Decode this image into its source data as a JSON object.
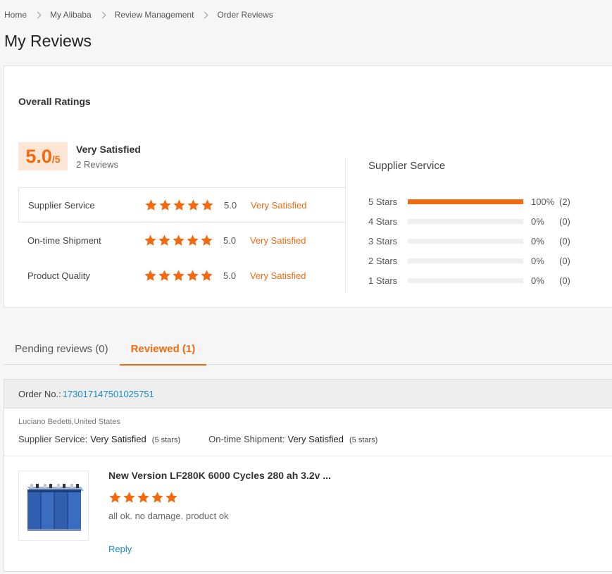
{
  "breadcrumb": [
    "Home",
    "My Alibaba",
    "Review Management",
    "Order Reviews"
  ],
  "page_title": "My Reviews",
  "overall": {
    "title": "Overall Ratings",
    "score": "5.0",
    "score_max": "/5",
    "label": "Very Satisfied",
    "review_count": "2 Reviews",
    "rows": [
      {
        "name": "Supplier Service",
        "stars": 5,
        "value": "5.0",
        "label": "Very Satisfied"
      },
      {
        "name": "On-time Shipment",
        "stars": 5,
        "value": "5.0",
        "label": "Very Satisfied"
      },
      {
        "name": "Product Quality",
        "stars": 5,
        "value": "5.0",
        "label": "Very Satisfied"
      }
    ]
  },
  "distribution": {
    "title": "Supplier Service",
    "rows": [
      {
        "label": "5  Stars",
        "fraction": 1.0,
        "percent": "100%",
        "count": "(2)"
      },
      {
        "label": "4  Stars",
        "fraction": 0.0,
        "percent": "0%",
        "count": "(0)"
      },
      {
        "label": "3  Stars",
        "fraction": 0.0,
        "percent": "0%",
        "count": "(0)"
      },
      {
        "label": "2  Stars",
        "fraction": 0.0,
        "percent": "0%",
        "count": "(0)"
      },
      {
        "label": "1  Stars",
        "fraction": 0.0,
        "percent": "0%",
        "count": "(0)"
      }
    ]
  },
  "tabs": [
    {
      "label": "Pending reviews (0)",
      "active": false
    },
    {
      "label": "Reviewed (1)",
      "active": true
    }
  ],
  "order": {
    "order_label": "Order No.:",
    "order_no": "173017147501025751",
    "buyer": "Luciano Bedetti,United States",
    "supplier_service_label": "Supplier Service:",
    "supplier_service_value": "Very Satisfied",
    "supplier_service_stars": "(5 stars)",
    "shipment_label": "On-time Shipment:",
    "shipment_value": "Very Satisfied",
    "shipment_stars": "(5 stars)",
    "product_title": "New Version LF280K 6000 Cycles 280 ah 3.2v ...",
    "review_stars": 5,
    "review_text": "all ok. no damage. product ok",
    "reply_label": "Reply"
  },
  "colors": {
    "accent": "#f26a10",
    "link": "#1a8bc6",
    "score_bg": "#fde6d6"
  },
  "icons": {
    "breadcrumb_separator": "chevron-right-icon",
    "rating_star": "star-icon",
    "product_image": "battery-cells-image"
  }
}
